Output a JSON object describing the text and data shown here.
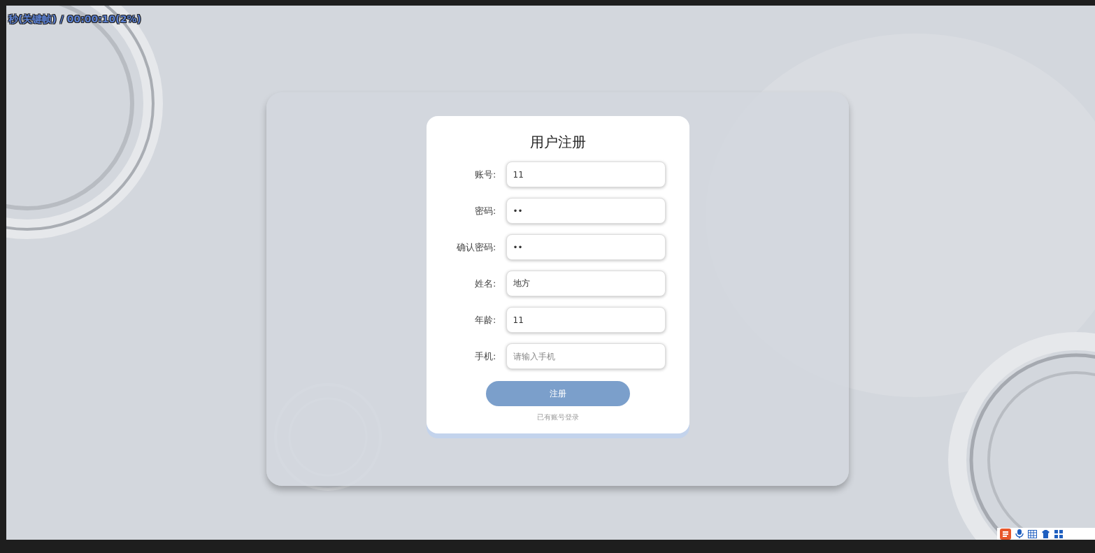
{
  "recorder_overlay": {
    "text": "秒(关键帧) / 00:00:10(2%)"
  },
  "form": {
    "title": "用户注册",
    "fields": [
      {
        "label": "账号:",
        "value": "11"
      },
      {
        "label": "密码:",
        "value": "••"
      },
      {
        "label": "确认密码:",
        "value": "••"
      },
      {
        "label": "姓名:",
        "value": "地方"
      },
      {
        "label": "年龄:",
        "value": "11"
      },
      {
        "label": "手机:",
        "placeholder": "请输入手机"
      }
    ],
    "submit": "注册",
    "login_link": "已有账号登录"
  }
}
